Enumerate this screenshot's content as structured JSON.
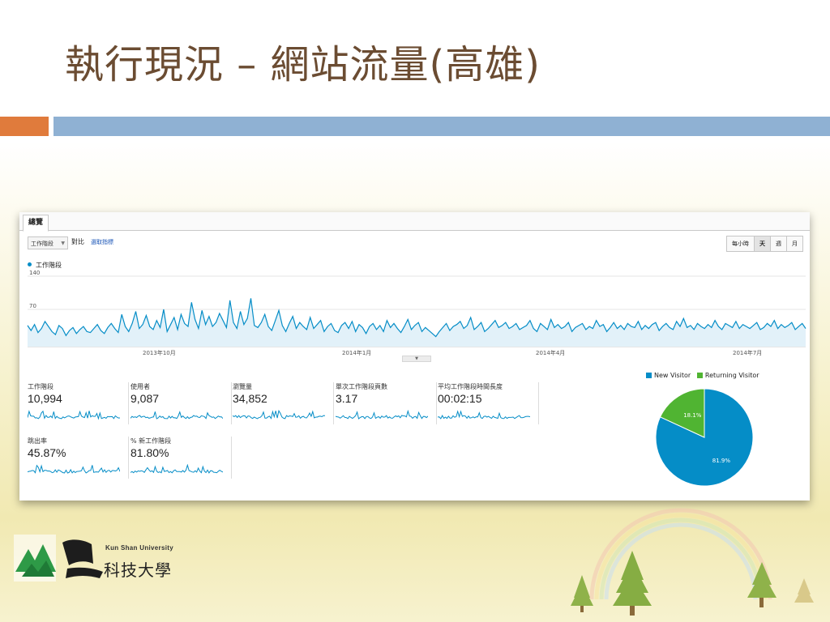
{
  "slide": {
    "title": "執行現況 – 網站流量(高雄)"
  },
  "dashboard": {
    "tab": "總覽",
    "metric_select": "工作階段",
    "compare": "對比",
    "select_metric": "選取指標",
    "periods": [
      {
        "label": "每小時",
        "active": false
      },
      {
        "label": "天",
        "active": true
      },
      {
        "label": "週",
        "active": false
      },
      {
        "label": "月",
        "active": false
      }
    ],
    "series_legend": "工作階段",
    "metrics": [
      {
        "label": "工作階段",
        "value": "10,994"
      },
      {
        "label": "使用者",
        "value": "9,087"
      },
      {
        "label": "瀏覽量",
        "value": "34,852"
      },
      {
        "label": "單次工作階段頁數",
        "value": "3.17"
      },
      {
        "label": "平均工作階段時間長度",
        "value": "00:02:15"
      },
      {
        "label": "跳出率",
        "value": "45.87%"
      },
      {
        "label": "% 新工作階段",
        "value": "81.80%"
      }
    ]
  },
  "chart_data": [
    {
      "type": "line",
      "series": [
        {
          "name": "工作階段",
          "values": []
        }
      ],
      "ylim": [
        0,
        140
      ],
      "yticks": [
        "140",
        "70"
      ],
      "xticks": [
        "2013年10月",
        "2014年1月",
        "2014年4月",
        "2014年7月"
      ],
      "grid": true,
      "legend": "top-left",
      "color": "#058dc7",
      "sample_series": [
        42,
        32,
        44,
        28,
        36,
        50,
        40,
        30,
        24,
        42,
        36,
        22,
        32,
        38,
        26,
        34,
        40,
        30,
        28,
        36,
        44,
        32,
        26,
        38,
        46,
        36,
        28,
        64,
        40,
        30,
        46,
        70,
        36,
        44,
        62,
        40,
        34,
        52,
        38,
        74,
        30,
        44,
        58,
        34,
        64,
        46,
        40,
        88,
        54,
        36,
        72,
        44,
        60,
        40,
        48,
        66,
        52,
        38,
        92,
        48,
        36,
        70,
        44,
        56,
        96,
        42,
        38,
        48,
        64,
        40,
        32,
        52,
        72,
        42,
        30,
        46,
        60,
        36,
        48,
        40,
        34,
        58,
        36,
        44,
        52,
        30,
        40,
        46,
        32,
        28,
        42,
        48,
        36,
        50,
        30,
        44,
        38,
        26,
        40,
        46,
        34,
        42,
        30,
        52,
        38,
        46,
        36,
        28,
        40,
        54,
        34,
        42,
        48,
        30,
        38,
        32,
        26,
        20,
        30,
        38,
        46,
        32,
        40,
        44,
        50,
        36,
        42,
        58,
        34,
        40,
        48,
        30,
        36,
        44,
        52,
        38,
        42,
        48,
        36,
        40,
        46,
        34,
        38,
        42,
        52,
        36,
        30,
        46,
        40,
        34,
        54,
        38,
        44,
        36,
        40,
        48,
        30,
        38,
        42,
        46,
        34,
        40,
        36,
        52,
        40,
        44,
        30,
        38,
        48,
        36,
        42,
        34,
        46,
        40,
        38,
        50,
        34,
        42,
        36,
        44,
        48,
        32,
        40,
        46,
        38,
        34,
        50,
        40,
        56,
        38,
        42,
        34,
        46,
        40,
        36,
        44,
        38,
        52,
        40,
        34,
        46,
        42,
        38,
        50,
        36,
        44,
        40,
        36,
        42,
        48,
        34,
        38,
        46,
        40,
        52,
        36,
        44,
        38,
        42,
        48,
        34,
        40,
        46,
        36
      ],
      "sample_sessions_count": 0
    },
    {
      "type": "pie",
      "categories": [
        "New Visitor",
        "Returning Visitor"
      ],
      "values": [
        81.9,
        18.1
      ],
      "labels": [
        "81.9%",
        "18.1%"
      ],
      "colors": [
        "#058dc7",
        "#50b432"
      ],
      "legend": "top"
    }
  ],
  "branding": {
    "university_en": "Kun Shan University",
    "university_zh": "科技大學"
  }
}
